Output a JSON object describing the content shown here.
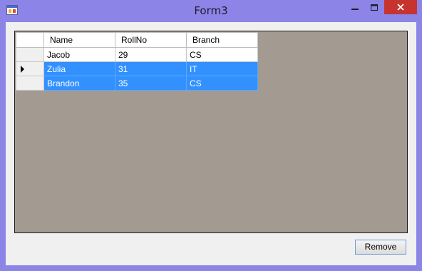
{
  "window": {
    "title": "Form3",
    "icon": "winforms-app-icon",
    "controls": {
      "minimize": "minimize-icon",
      "maximize": "maximize-icon",
      "close": "close-icon"
    }
  },
  "grid": {
    "columns": [
      "Name",
      "RollNo",
      "Branch"
    ],
    "rows": [
      {
        "name": "Jacob",
        "rollno": "29",
        "branch": "CS",
        "selected": false,
        "current": false
      },
      {
        "name": "Zulia",
        "rollno": "31",
        "branch": "IT",
        "selected": true,
        "current": true
      },
      {
        "name": "Brandon",
        "rollno": "35",
        "branch": "CS",
        "selected": true,
        "current": false
      }
    ],
    "selection_color": "#3391ff",
    "background_color": "#a39a92"
  },
  "buttons": {
    "remove_label": "Remove"
  }
}
